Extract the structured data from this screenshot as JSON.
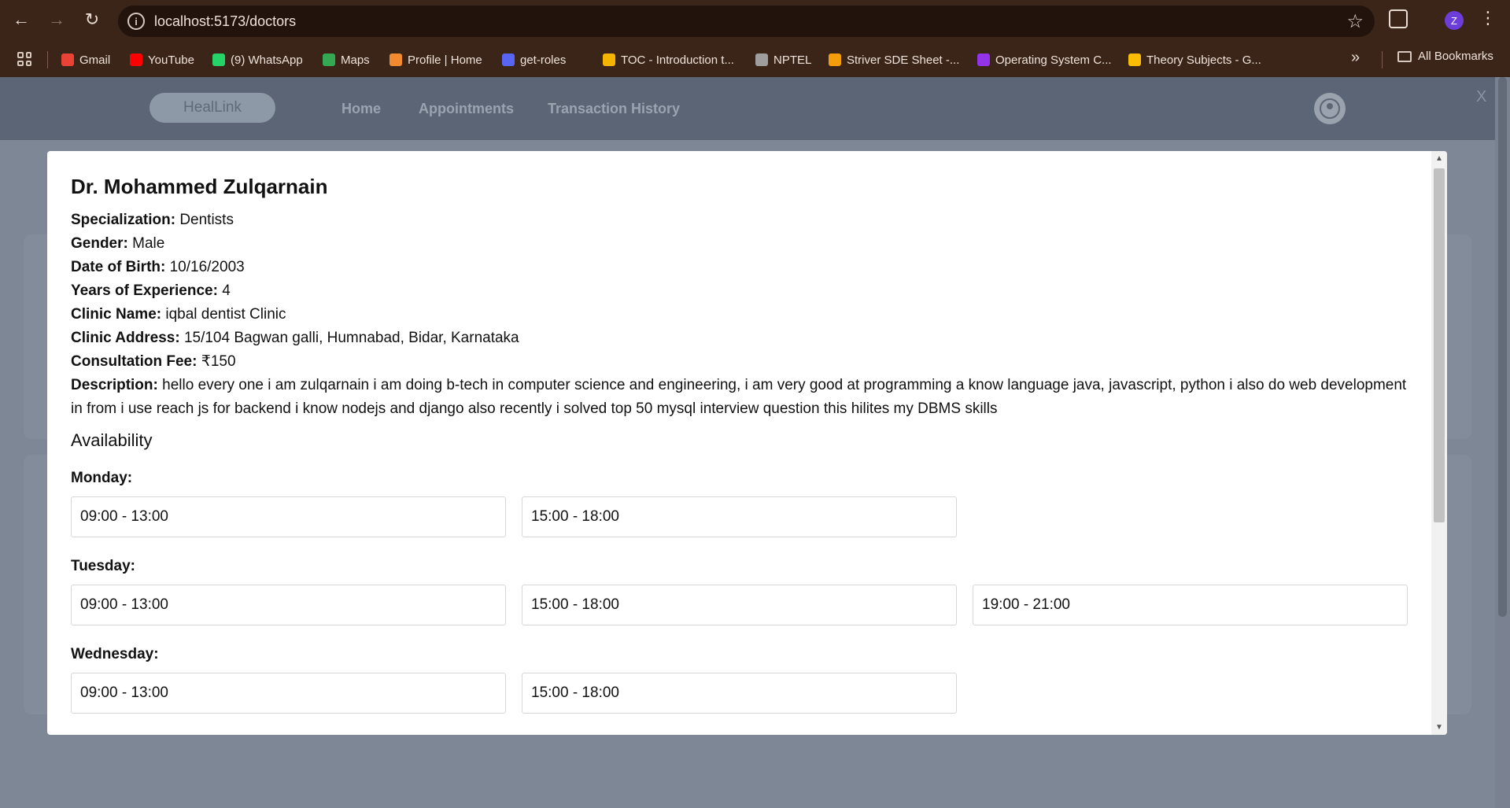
{
  "browser": {
    "url": "localhost:5173/doctors",
    "profile_initial": "Z",
    "bookmarks": [
      {
        "label": "Gmail",
        "color": "#ea4335"
      },
      {
        "label": "YouTube",
        "color": "#ff0000"
      },
      {
        "label": "(9) WhatsApp",
        "color": "#25d366"
      },
      {
        "label": "Maps",
        "color": "#34a853"
      },
      {
        "label": "Profile | Home",
        "color": "#f28b30"
      },
      {
        "label": "get-roles",
        "color": "#5865f2"
      },
      {
        "label": "TOC - Introduction t...",
        "color": "#f4b400"
      },
      {
        "label": "NPTEL",
        "color": "#9e9e9e"
      },
      {
        "label": "Striver SDE Sheet -...",
        "color": "#f59e0b"
      },
      {
        "label": "Operating System C...",
        "color": "#9333ea"
      },
      {
        "label": "Theory Subjects - G...",
        "color": "#fbbc04"
      }
    ],
    "all_bookmarks": "All Bookmarks"
  },
  "app": {
    "logo": "HealLink",
    "nav": [
      "Home",
      "Appointments",
      "Transaction History"
    ],
    "close": "X"
  },
  "doctor": {
    "name": "Dr. Mohammed Zulqarnain",
    "fields": [
      {
        "label": "Specialization:",
        "value": "Dentists"
      },
      {
        "label": "Gender:",
        "value": "Male"
      },
      {
        "label": "Date of Birth:",
        "value": "10/16/2003"
      },
      {
        "label": "Years of Experience:",
        "value": "4"
      },
      {
        "label": "Clinic Name:",
        "value": "iqbal dentist Clinic"
      },
      {
        "label": "Clinic Address:",
        "value": "15/104 Bagwan galli, Humnabad, Bidar, Karnataka"
      },
      {
        "label": "Consultation Fee:",
        "value": "₹150"
      },
      {
        "label": "Description:",
        "value": "hello every one i am zulqarnain i am doing b-tech in computer science and engineering, i am very good at programming a know language java, javascript, python i also do web development in from i use reach js for backend i know nodejs and django also recently i solved top 50 mysql interview question this hilites my DBMS skills"
      }
    ]
  },
  "availability": {
    "title": "Availability",
    "days": [
      {
        "label": "Monday:",
        "slots": [
          "09:00 - 13:00",
          "15:00 - 18:00"
        ]
      },
      {
        "label": "Tuesday:",
        "slots": [
          "09:00 - 13:00",
          "15:00 - 18:00",
          "19:00 - 21:00"
        ]
      },
      {
        "label": "Wednesday:",
        "slots": [
          "09:00 - 13:00",
          "15:00 - 18:00"
        ]
      }
    ]
  }
}
